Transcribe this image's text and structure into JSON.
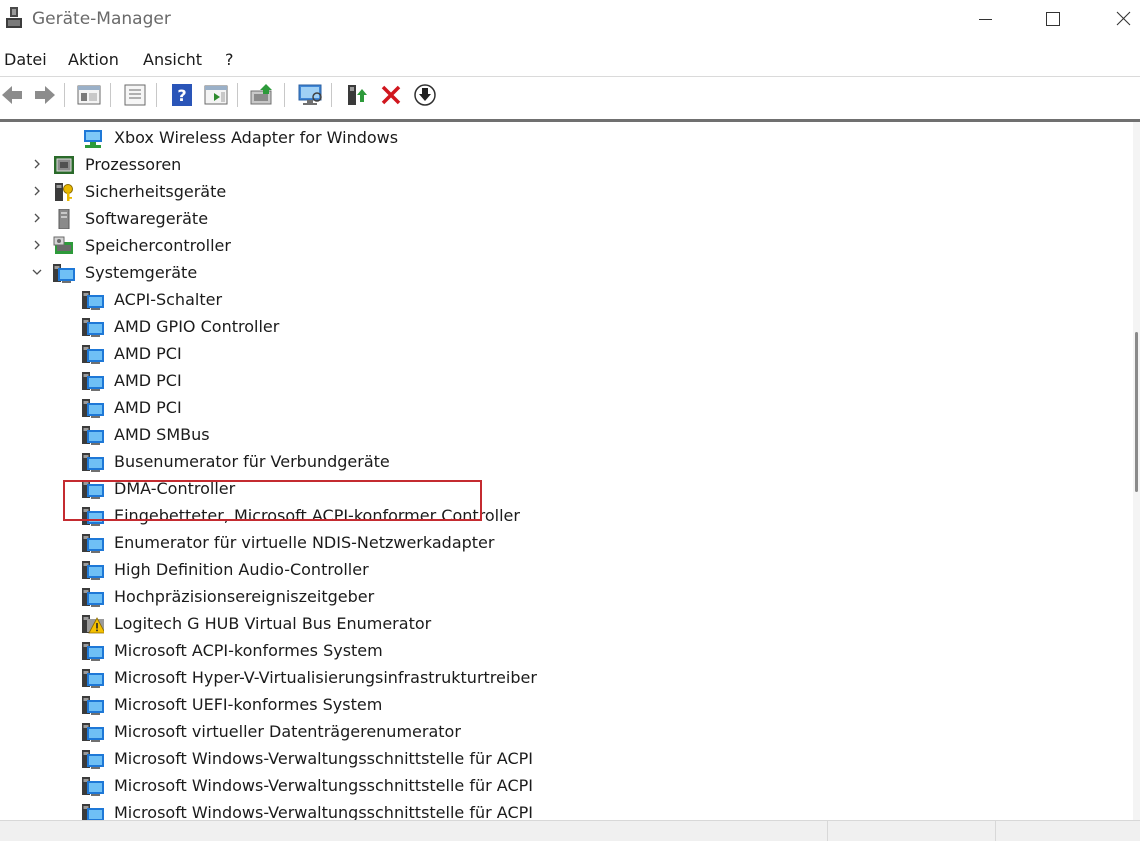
{
  "window": {
    "title": "Geräte-Manager"
  },
  "menu": {
    "datei": "Datei",
    "aktion": "Aktion",
    "ansicht": "Ansicht",
    "hilfe": "?"
  },
  "toolbar": {
    "buttons": [
      {
        "icon": "back-arrow-icon"
      },
      {
        "icon": "forward-arrow-icon"
      },
      {
        "icon": "show-hide-console-tree-icon"
      },
      {
        "icon": "properties-icon"
      },
      {
        "icon": "help-icon"
      },
      {
        "icon": "action-pane-icon"
      },
      {
        "icon": "update-driver-icon"
      },
      {
        "icon": "scan-hardware-icon"
      },
      {
        "icon": "enable-device-icon"
      },
      {
        "icon": "uninstall-device-icon"
      },
      {
        "icon": "disable-device-icon"
      }
    ]
  },
  "tree": {
    "items": [
      {
        "label": "Xbox Wireless Adapter for Windows",
        "level": 1,
        "icon": "network-adapter-icon"
      },
      {
        "label": "Prozessoren",
        "level": 0,
        "expanded": false,
        "icon": "processor-icon"
      },
      {
        "label": "Sicherheitsgeräte",
        "level": 0,
        "expanded": false,
        "icon": "security-device-icon"
      },
      {
        "label": "Softwaregeräte",
        "level": 0,
        "expanded": false,
        "icon": "software-device-icon"
      },
      {
        "label": "Speichercontroller",
        "level": 0,
        "expanded": false,
        "icon": "storage-controller-icon"
      },
      {
        "label": "Systemgeräte",
        "level": 0,
        "expanded": true,
        "icon": "system-device-icon"
      },
      {
        "label": "ACPI-Schalter",
        "level": 1,
        "icon": "system-device-icon"
      },
      {
        "label": "AMD GPIO Controller",
        "level": 1,
        "icon": "system-device-icon"
      },
      {
        "label": "AMD PCI",
        "level": 1,
        "icon": "system-device-icon"
      },
      {
        "label": "AMD PCI",
        "level": 1,
        "icon": "system-device-icon"
      },
      {
        "label": "AMD PCI",
        "level": 1,
        "icon": "system-device-icon"
      },
      {
        "label": "AMD SMBus",
        "level": 1,
        "icon": "system-device-icon"
      },
      {
        "label": "Busenumerator für Verbundgeräte",
        "level": 1,
        "icon": "system-device-icon"
      },
      {
        "label": "DMA-Controller",
        "level": 1,
        "icon": "system-device-icon"
      },
      {
        "label": "Eingebetteter, Microsoft ACPI-konformer Controller",
        "level": 1,
        "icon": "system-device-icon"
      },
      {
        "label": "Enumerator für virtuelle NDIS-Netzwerkadapter",
        "level": 1,
        "icon": "system-device-icon"
      },
      {
        "label": "High Definition Audio-Controller",
        "level": 1,
        "icon": "system-device-icon"
      },
      {
        "label": "Hochpräzisionsereigniszeitgeber",
        "level": 1,
        "icon": "system-device-icon"
      },
      {
        "label": "Logitech G HUB Virtual Bus Enumerator",
        "level": 1,
        "icon": "warning-device-icon",
        "warning": true
      },
      {
        "label": "Microsoft ACPI-konformes System",
        "level": 1,
        "icon": "system-device-icon"
      },
      {
        "label": "Microsoft Hyper-V-Virtualisierungsinfrastrukturtreiber",
        "level": 1,
        "icon": "system-device-icon"
      },
      {
        "label": "Microsoft UEFI-konformes System",
        "level": 1,
        "icon": "system-device-icon"
      },
      {
        "label": "Microsoft virtueller Datenträgerenumerator",
        "level": 1,
        "icon": "system-device-icon"
      },
      {
        "label": "Microsoft Windows-Verwaltungsschnittstelle für ACPI",
        "level": 1,
        "icon": "system-device-icon"
      },
      {
        "label": "Microsoft Windows-Verwaltungsschnittstelle für ACPI",
        "level": 1,
        "icon": "system-device-icon"
      },
      {
        "label": "Microsoft Windows-Verwaltungsschnittstelle für ACPI",
        "level": 1,
        "icon": "system-device-icon"
      }
    ]
  },
  "colors": {
    "highlight_border": "#c42b30",
    "icon_blue": "#1e78d7",
    "warning_yellow": "#f5c000"
  }
}
